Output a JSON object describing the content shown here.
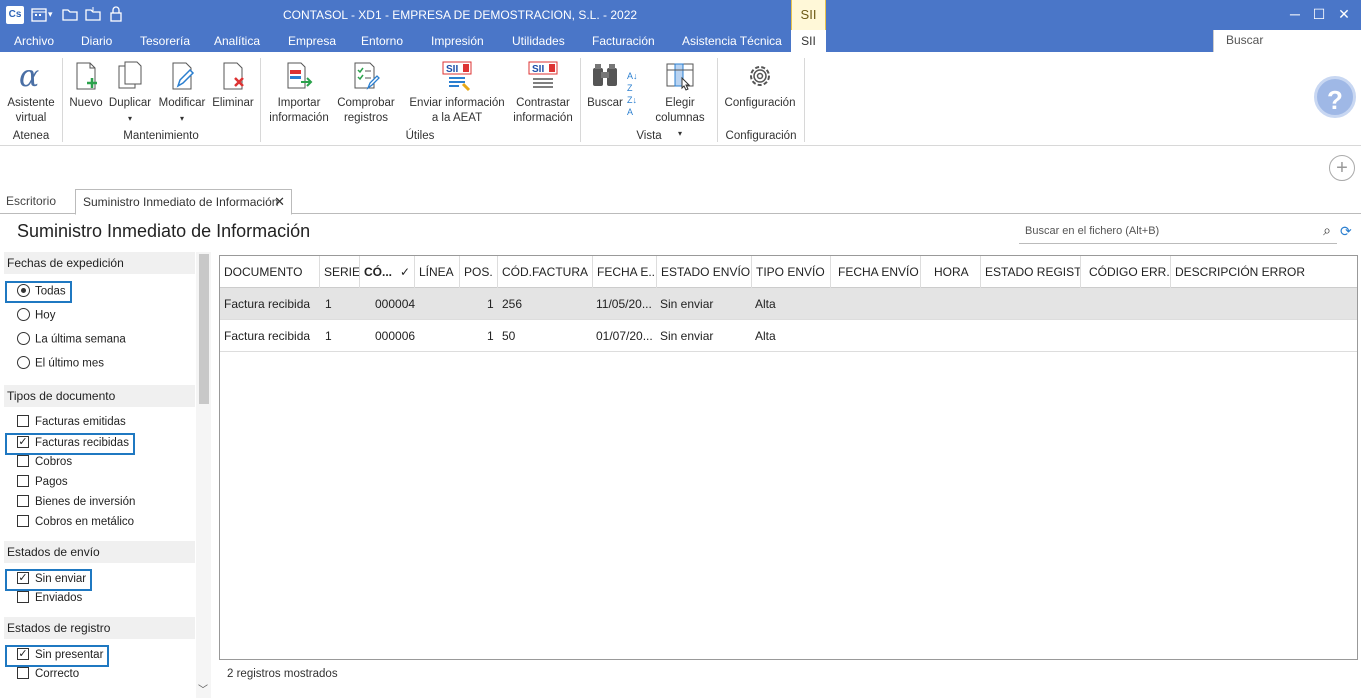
{
  "app": {
    "icon_text": "Cs",
    "title": "CONTASOL - XD1 - EMPRESA DE DEMOSTRACION, S.L. - 2022",
    "context_tab": "SII"
  },
  "menu": {
    "items": [
      "Archivo",
      "Diario",
      "Tesorería",
      "Analítica",
      "Empresa",
      "Entorno",
      "Impresión",
      "Utilidades",
      "Facturación",
      "Asistencia Técnica"
    ],
    "active": "SII",
    "search_placeholder": "Buscar"
  },
  "ribbon": {
    "buttons": {
      "asistente": "Asistente virtual",
      "nuevo": "Nuevo",
      "duplicar": "Duplicar",
      "modificar": "Modificar",
      "eliminar": "Eliminar",
      "importar": "Importar información",
      "comprobar": "Comprobar registros",
      "enviar": "Enviar información a la AEAT",
      "contrastar": "Contrastar información",
      "buscar": "Buscar",
      "elegir": "Elegir columnas",
      "configuracion": "Configuración"
    },
    "groups": {
      "atenea": "Atenea",
      "mantenimiento": "Mantenimiento",
      "utiles": "Útiles",
      "vista": "Vista",
      "configuracion": "Configuración"
    }
  },
  "tabs": {
    "escritorio": "Escritorio",
    "current": "Suministro Inmediato de Información"
  },
  "page": {
    "title": "Suministro Inmediato de Información",
    "search_placeholder": "Buscar en el fichero (Alt+B)"
  },
  "filters": {
    "fechas": {
      "header": "Fechas de expedición",
      "options": [
        "Todas",
        "Hoy",
        "La última semana",
        "El último mes"
      ],
      "selected": "Todas"
    },
    "tipos": {
      "header": "Tipos de documento",
      "options": [
        "Facturas emitidas",
        "Facturas recibidas",
        "Cobros",
        "Pagos",
        "Bienes de inversión",
        "Cobros en metálico"
      ],
      "checked": [
        "Facturas recibidas"
      ]
    },
    "envio": {
      "header": "Estados de envío",
      "options": [
        "Sin enviar",
        "Enviados"
      ],
      "checked": [
        "Sin enviar"
      ]
    },
    "registro": {
      "header": "Estados de registro",
      "options": [
        "Sin presentar",
        "Correcto"
      ],
      "checked": [
        "Sin presentar"
      ]
    }
  },
  "grid": {
    "columns": [
      "DOCUMENTO",
      "SERIE",
      "CÓ...",
      "LÍNEA",
      "POS.",
      "CÓD.FACTURA",
      "FECHA E...",
      "ESTADO ENVÍO",
      "TIPO ENVÍO",
      "FECHA ENVÍO",
      "HORA",
      "ESTADO REGIST...",
      "CÓDIGO ERR...",
      "DESCRIPCIÓN ERROR"
    ],
    "rows": [
      {
        "documento": "Factura recibida",
        "serie": "1",
        "codigo": "000004",
        "linea": "",
        "pos": "1",
        "cod_factura": "256",
        "fecha": "11/05/20...",
        "estado_envio": "Sin enviar",
        "tipo_envio": "Alta"
      },
      {
        "documento": "Factura recibida",
        "serie": "1",
        "codigo": "000006",
        "linea": "",
        "pos": "1",
        "cod_factura": "50",
        "fecha": "01/07/20...",
        "estado_envio": "Sin enviar",
        "tipo_envio": "Alta"
      }
    ],
    "status": "2 registros mostrados"
  }
}
